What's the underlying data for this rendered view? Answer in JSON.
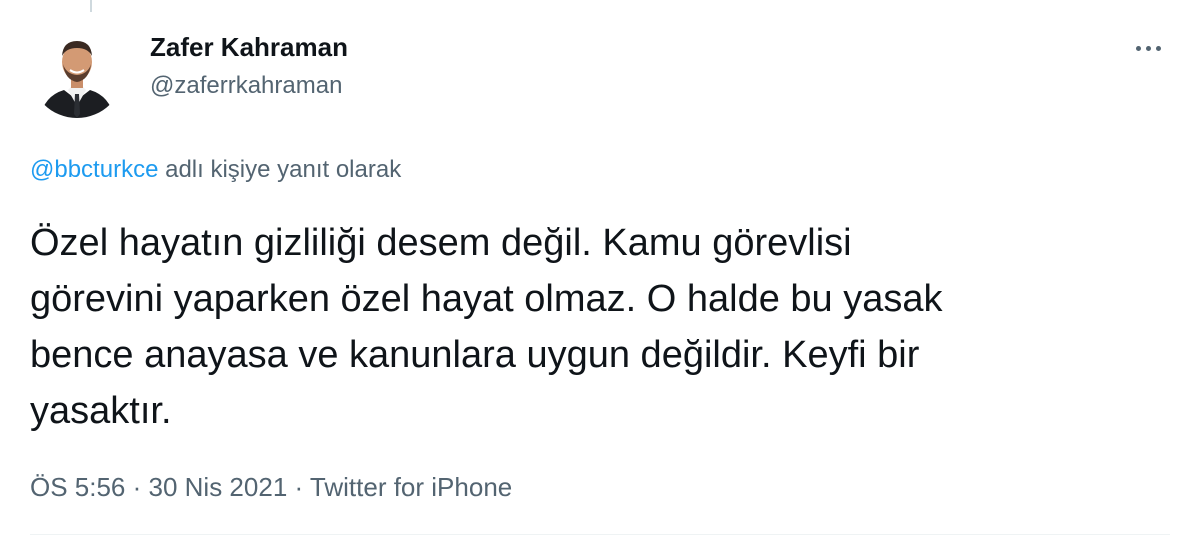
{
  "tweet": {
    "author": {
      "display_name": "Zafer Kahraman",
      "handle": "@zaferrkahraman",
      "avatar": "profile-photo-man-in-suit"
    },
    "reply_context": {
      "mention": "@bbcturkce",
      "suffix": " adlı kişiye yanıt olarak"
    },
    "text_lines": [
      "Özel hayatın gizliliği desem değil. Kamu görevlisi",
      "görevini yaparken özel hayat olmaz. O halde bu yasak",
      "bence anayasa ve kanunlara uygun değildir. Keyfi bir",
      "yasaktır."
    ],
    "meta": {
      "time": "ÖS 5:56",
      "separator": " · ",
      "date": "30 Nis 2021",
      "source": "Twitter for iPhone"
    },
    "more_icon": "more-horizontal-icon"
  },
  "colors": {
    "text": "#0f1419",
    "secondary": "#536471",
    "link": "#1d9bf0",
    "divider": "#eff3f4"
  }
}
